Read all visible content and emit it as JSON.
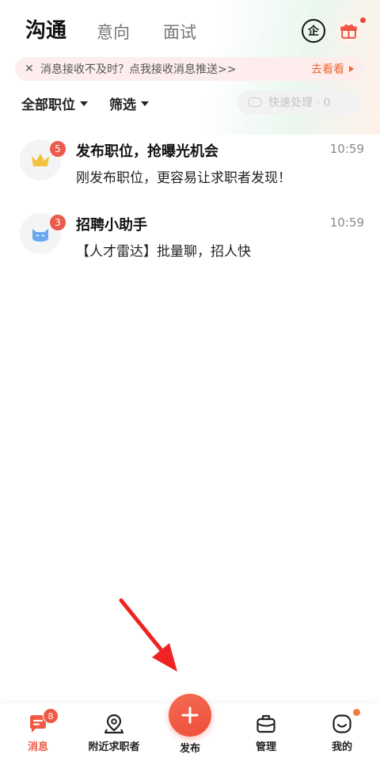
{
  "header": {
    "tabs": [
      "沟通",
      "意向",
      "面试"
    ],
    "corp_icon_label": "企"
  },
  "notice": {
    "close": "✕",
    "text": "消息接收不及时？点我接收消息推送>>",
    "link": "去看看"
  },
  "filters": {
    "position": "全部职位",
    "screen": "筛选",
    "quick_action": "快速处理 · 0"
  },
  "conversations": [
    {
      "title": "发布职位，抢曝光机会",
      "time": "10:59",
      "subtitle": "刚发布职位，更容易让求职者发现！",
      "badge": "5",
      "avatar_icon": "crown-icon"
    },
    {
      "title": "招聘小助手",
      "time": "10:59",
      "subtitle": "【人才雷达】批量聊，招人快",
      "badge": "3",
      "avatar_icon": "cat-icon"
    }
  ],
  "bottom_nav": {
    "items": [
      "消息",
      "附近求职者",
      "发布",
      "管理",
      "我的"
    ],
    "message_badge": "8"
  },
  "colors": {
    "accent": "#ef5a45",
    "link": "#f2652f",
    "arrow": "#ee2424"
  }
}
